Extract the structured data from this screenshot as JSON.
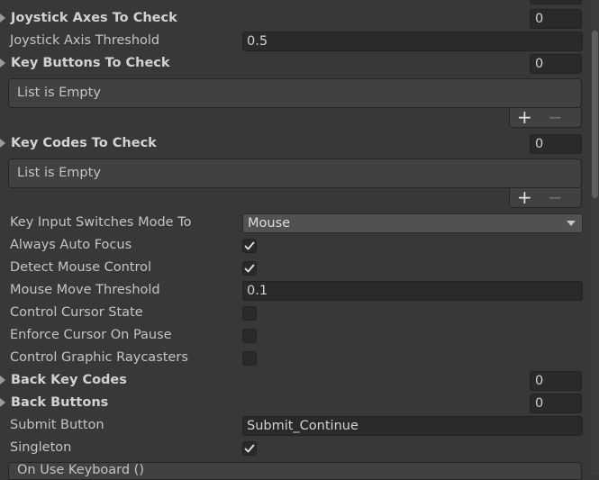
{
  "rows": {
    "joystick_axes": {
      "label": "Joystick Axes To Check",
      "count": "0"
    },
    "joystick_threshold": {
      "label": "Joystick Axis Threshold",
      "value": "0.5"
    },
    "key_buttons": {
      "label": "Key Buttons To Check",
      "count": "0",
      "empty_text": "List is Empty"
    },
    "key_codes": {
      "label": "Key Codes To Check",
      "count": "0",
      "empty_text": "List is Empty"
    },
    "key_input_mode": {
      "label": "Key Input Switches Mode To",
      "value": "Mouse"
    },
    "always_auto_focus": {
      "label": "Always Auto Focus",
      "checked": true
    },
    "detect_mouse": {
      "label": "Detect Mouse Control",
      "checked": true
    },
    "mouse_threshold": {
      "label": "Mouse Move Threshold",
      "value": "0.1"
    },
    "control_cursor": {
      "label": "Control Cursor State",
      "checked": false
    },
    "enforce_cursor": {
      "label": "Enforce Cursor On Pause",
      "checked": false
    },
    "control_raycasters": {
      "label": "Control Graphic Raycasters",
      "checked": false
    },
    "back_key_codes": {
      "label": "Back Key Codes",
      "count": "0"
    },
    "back_buttons": {
      "label": "Back Buttons",
      "count": "0"
    },
    "submit_button": {
      "label": "Submit Button",
      "value": "Submit_Continue"
    },
    "singleton": {
      "label": "Singleton",
      "checked": true
    },
    "on_use_keyboard": {
      "label": "On Use Keyboard ()"
    }
  },
  "list_controls": {
    "add": "+",
    "remove": "−"
  },
  "icons": {
    "foldout": "foldout-arrow-icon",
    "check": "checkmark-icon",
    "dropdown": "dropdown-arrow-icon"
  }
}
